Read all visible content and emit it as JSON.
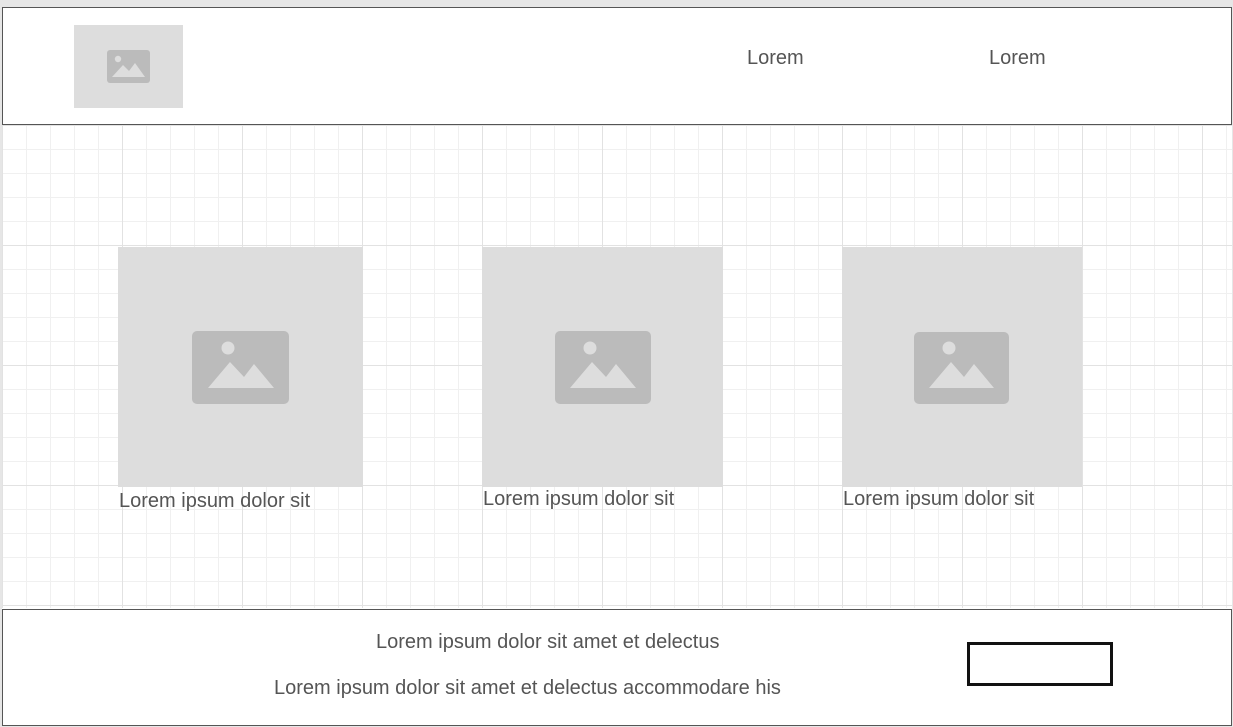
{
  "header": {
    "logo_icon": "image-placeholder-icon",
    "nav": [
      {
        "label": "Lorem"
      },
      {
        "label": "Lorem"
      }
    ]
  },
  "main": {
    "cards": [
      {
        "icon": "image-placeholder-icon",
        "caption": "Lorem ipsum dolor sit"
      },
      {
        "icon": "image-placeholder-icon",
        "caption": "Lorem ipsum dolor sit"
      },
      {
        "icon": "image-placeholder-icon",
        "caption": "Lorem ipsum dolor sit"
      }
    ]
  },
  "footer": {
    "line1": "Lorem ipsum dolor sit amet et delectus",
    "line2": "Lorem ipsum dolor sit amet et delectus accommodare his"
  },
  "colors": {
    "placeholder_bg": "#dddddd",
    "placeholder_icon": "#bbbbbb",
    "text": "#555555",
    "border": "#555555",
    "grid_major": "#e2e2e2",
    "grid_minor": "#f0f0f0"
  }
}
